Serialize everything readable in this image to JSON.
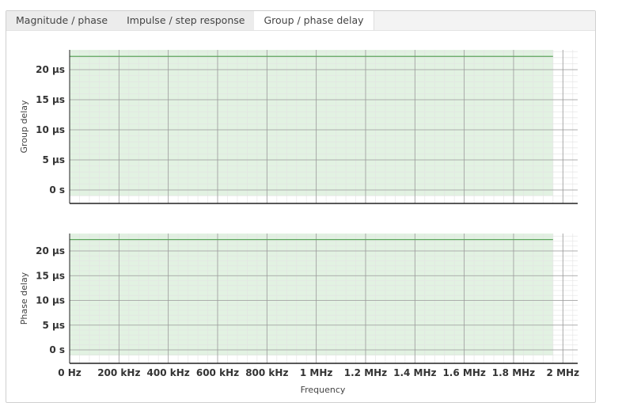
{
  "tabs": [
    {
      "label": "Magnitude / phase"
    },
    {
      "label": "Impulse / step response"
    },
    {
      "label": "Group / phase delay"
    }
  ],
  "active_tab": 2,
  "colors": {
    "fill": "#e2f2e2",
    "line": "#5ea55e",
    "major_grid": "#9a9a9a",
    "minor_grid": "#e4e4e4"
  },
  "chart_data": [
    {
      "type": "line",
      "title": "",
      "ylabel": "Group delay",
      "xlabel": "",
      "x_unit": "Hz",
      "xlim": [
        0,
        2060000
      ],
      "ylim": [
        -1.5,
        23.5
      ],
      "yticks": [
        0,
        5,
        10,
        15,
        20
      ],
      "ytick_labels": [
        "0 s",
        "5 µs",
        "10 µs",
        "15 µs",
        "20 µs"
      ],
      "series": [
        {
          "name": "Group delay",
          "x": [
            0,
            1960000
          ],
          "y": [
            22.2,
            22.2
          ]
        }
      ],
      "grid": true
    },
    {
      "type": "line",
      "title": "",
      "ylabel": "Phase delay",
      "xlabel": "Frequency",
      "x_unit": "Hz",
      "xlim": [
        0,
        2060000
      ],
      "ylim": [
        -1.5,
        23.5
      ],
      "yticks": [
        0,
        5,
        10,
        15,
        20
      ],
      "ytick_labels": [
        "0 s",
        "5 µs",
        "10 µs",
        "15 µs",
        "20 µs"
      ],
      "xticks": [
        0,
        200000,
        400000,
        600000,
        800000,
        1000000,
        1200000,
        1400000,
        1600000,
        1800000,
        2000000
      ],
      "xtick_labels": [
        "0 Hz",
        "200 kHz",
        "400 kHz",
        "600 kHz",
        "800 kHz",
        "1 MHz",
        "1.2 MHz",
        "1.4 MHz",
        "1.6 MHz",
        "1.8 MHz",
        "2 MHz"
      ],
      "series": [
        {
          "name": "Phase delay",
          "x": [
            0,
            1960000
          ],
          "y": [
            22.3,
            22.3
          ]
        }
      ],
      "grid": true
    }
  ]
}
